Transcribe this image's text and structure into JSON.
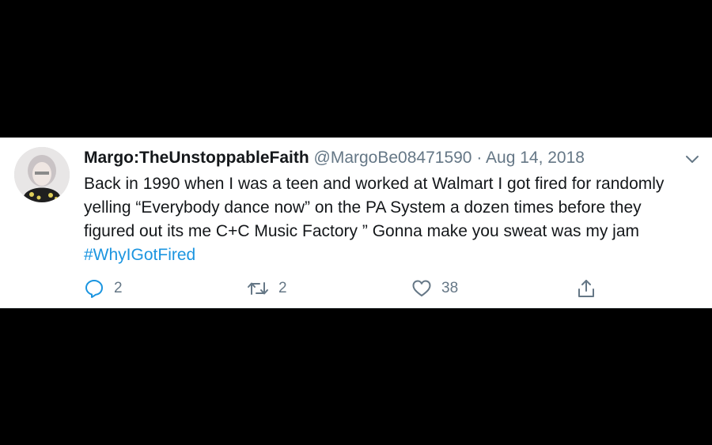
{
  "tweet": {
    "display_name": "Margo:TheUnstoppableFaith",
    "handle": "@MargoBe08471590",
    "separator": "·",
    "timestamp": "Aug 14, 2018",
    "text_before_hashtag": "Back in 1990 when I was a teen and worked at Walmart I got fired for randomly yelling “Everybody dance now” on the PA System a dozen times before they figured out its me C+C Music Factory ” Gonna make you sweat was my jam ",
    "hashtag": "#WhyIGotFired",
    "menu_icon": "chevron-down-icon",
    "avatar_icon": "avatar"
  },
  "actions": {
    "reply": {
      "icon": "reply-icon",
      "count": "2"
    },
    "retweet": {
      "icon": "retweet-icon",
      "count": "2"
    },
    "like": {
      "icon": "heart-icon",
      "count": "38"
    },
    "share": {
      "icon": "share-icon"
    }
  },
  "colors": {
    "background": "#000000",
    "card": "#ffffff",
    "text": "#14171a",
    "secondary": "#657786",
    "link": "#1b95e0"
  }
}
